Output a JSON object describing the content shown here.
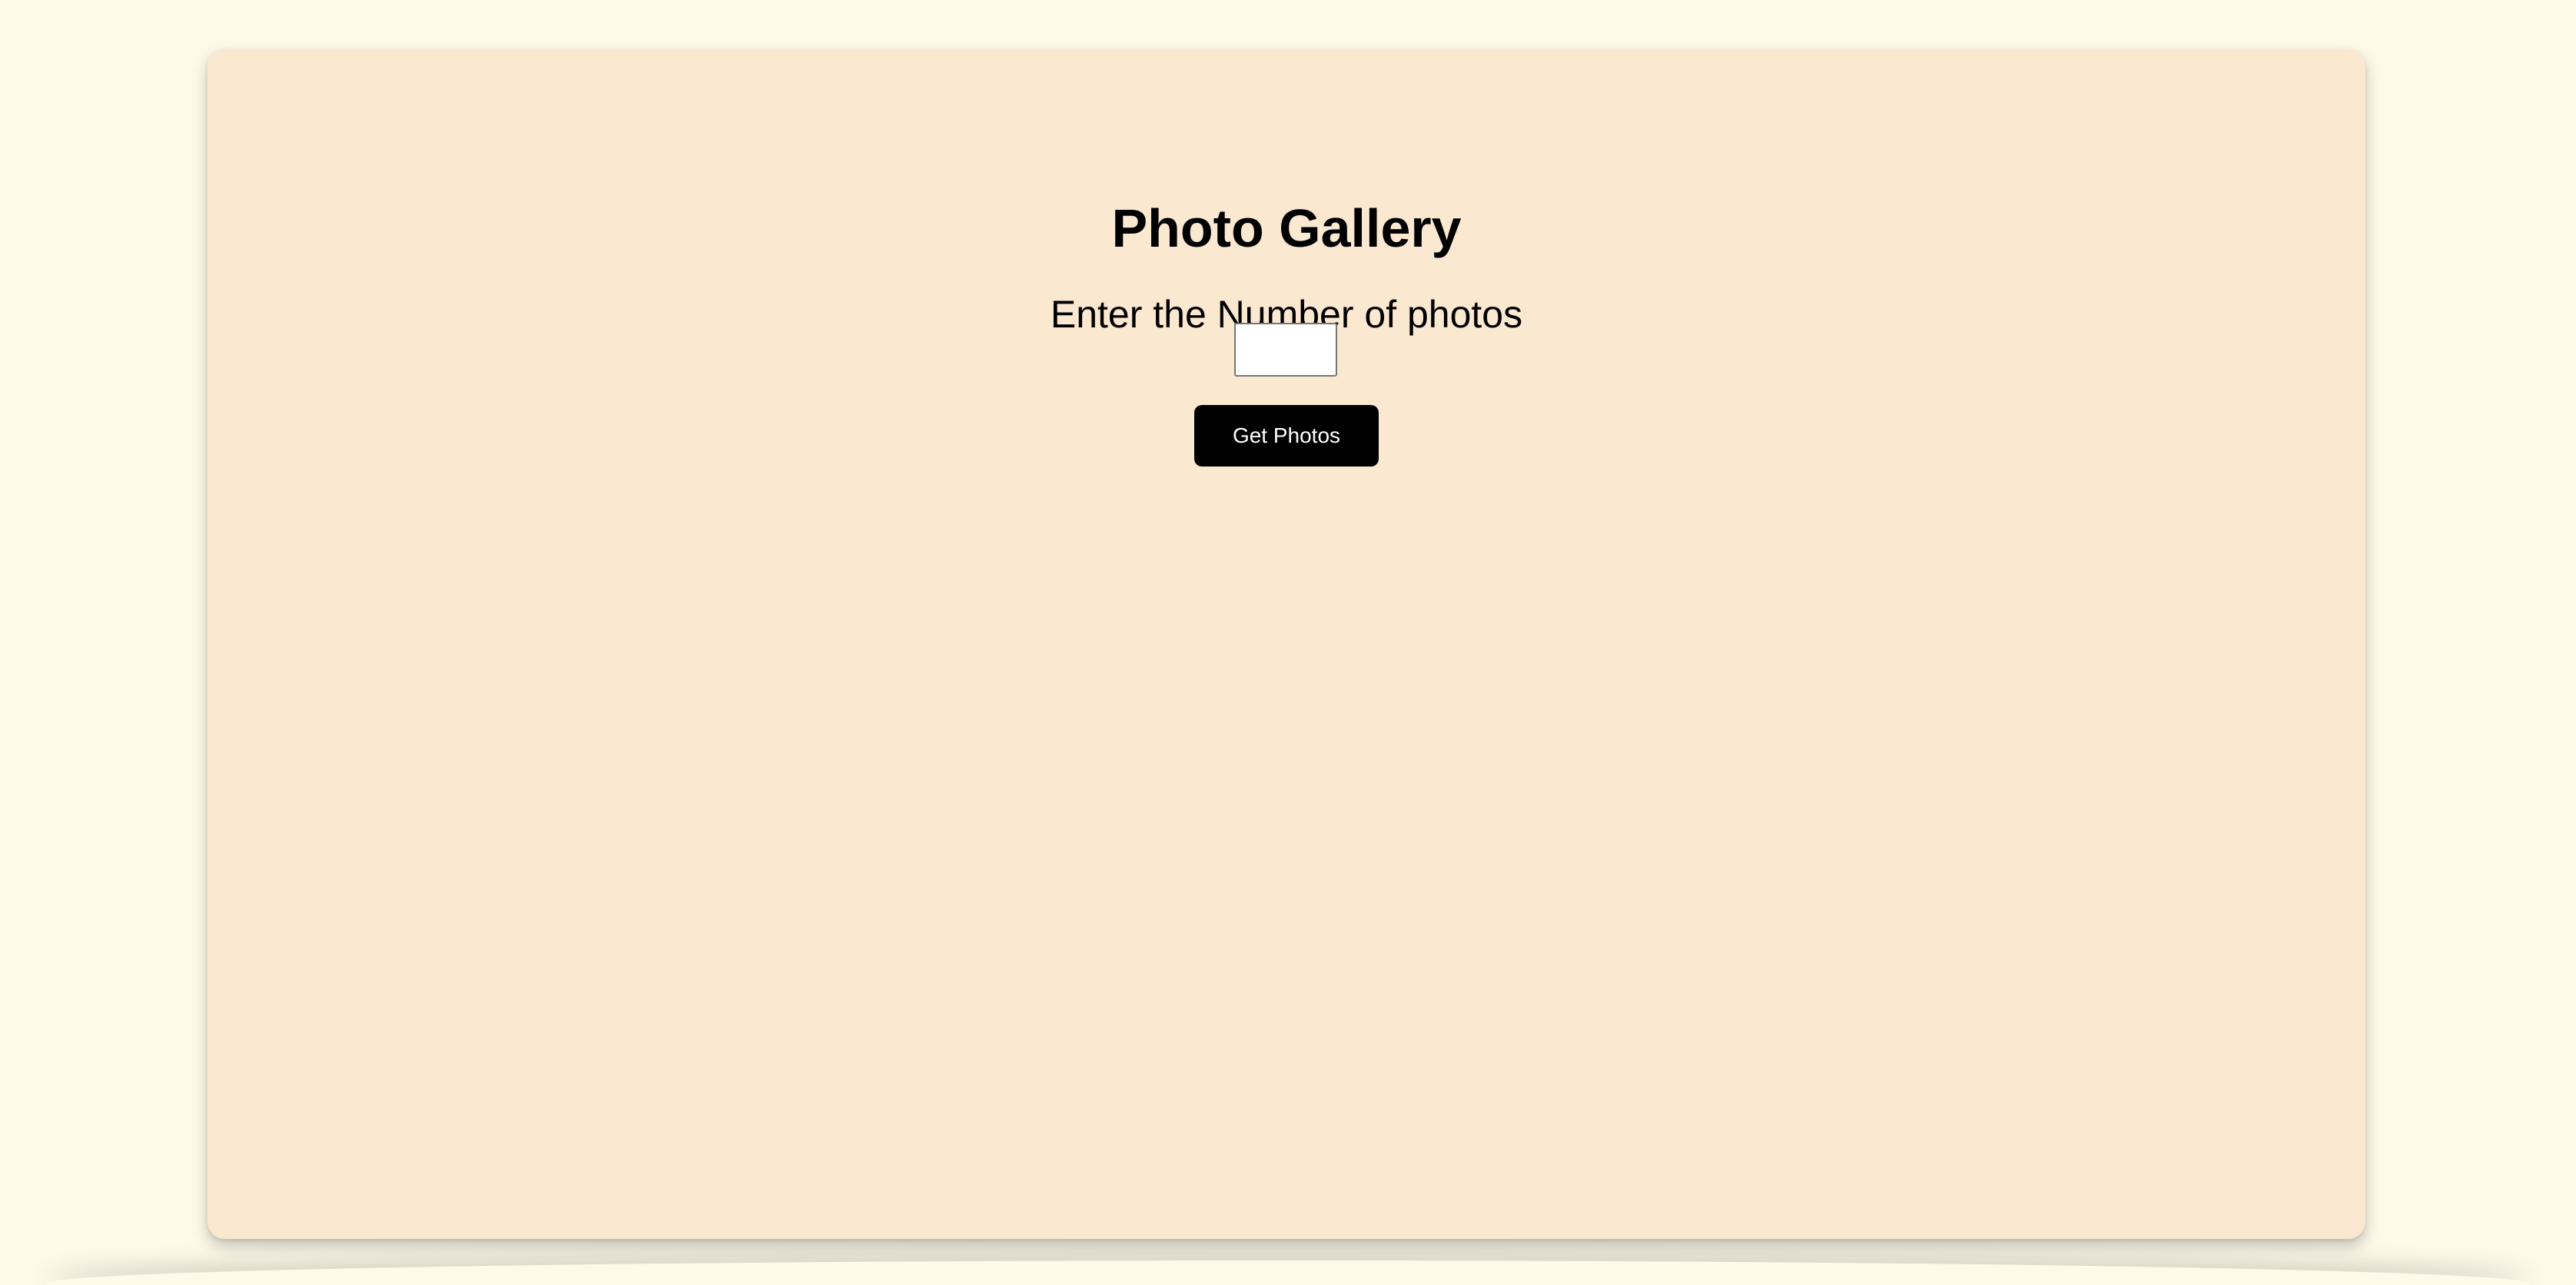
{
  "gallery": {
    "title": "Photo Gallery",
    "prompt": "Enter the Number of photos",
    "count_input": {
      "value": "",
      "placeholder": ""
    },
    "submit_label": "Get Photos"
  },
  "colors": {
    "page_background": "#fefaea",
    "card_background": "#fbe8d1",
    "button_background": "#000000",
    "button_text": "#ffffff"
  }
}
